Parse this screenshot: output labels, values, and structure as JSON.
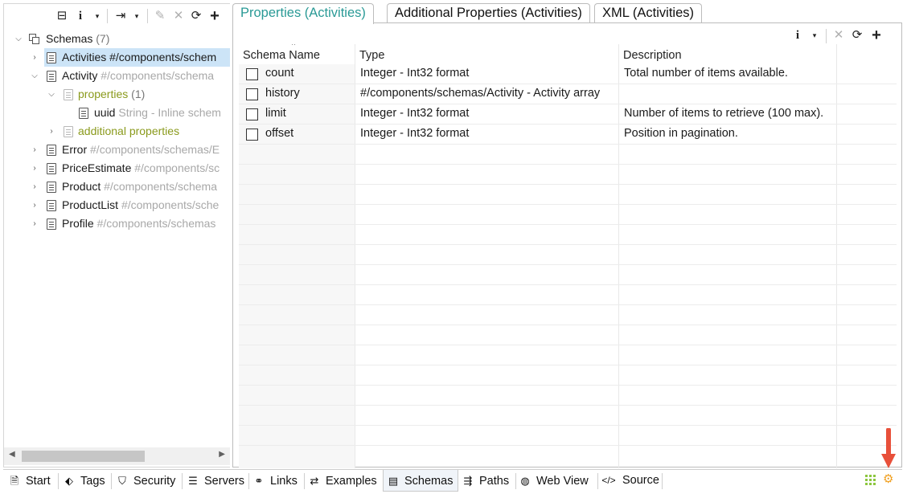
{
  "left_toolbar": {
    "collapse_icon": "⊟",
    "info_icon": "i",
    "caret": "▾",
    "export_icon": "⇥",
    "edit_icon": "✎",
    "delete_icon": "✕",
    "refresh_icon": "⟳",
    "add_icon": "+"
  },
  "tree": {
    "root": {
      "label": "Schemas",
      "count": "(7)"
    },
    "items": [
      {
        "label": "Activities",
        "ref": "#/components/schem"
      },
      {
        "label": "Activity",
        "ref": "#/components/schema"
      },
      {
        "label": "properties",
        "count": "(1)"
      },
      {
        "label": "uuid",
        "ref": "String - Inline schem"
      },
      {
        "label": "additional properties"
      },
      {
        "label": "Error",
        "ref": "#/components/schemas/E"
      },
      {
        "label": "PriceEstimate",
        "ref": "#/components/sc"
      },
      {
        "label": "Product",
        "ref": "#/components/schema"
      },
      {
        "label": "ProductList",
        "ref": "#/components/sche"
      },
      {
        "label": "Profile",
        "ref": "#/components/schemas"
      }
    ]
  },
  "tabs": [
    {
      "label": "Properties (Activities)",
      "active": true
    },
    {
      "label": "Additional Properties (Activities)",
      "active": false
    },
    {
      "label": "XML (Activities)",
      "active": false
    }
  ],
  "table_toolbar": {
    "info_icon": "i",
    "caret": "▾",
    "delete_icon": "✕",
    "refresh_icon": "⟳",
    "add_icon": "+"
  },
  "table": {
    "headers": [
      "Schema Name",
      "Type",
      "Description"
    ],
    "rows": [
      {
        "name": "count",
        "type": "Integer - Int32 format",
        "description": "Total number of items available."
      },
      {
        "name": "history",
        "type": "#/components/schemas/Activity - Activity array",
        "description": ""
      },
      {
        "name": "limit",
        "type": "Integer - Int32 format",
        "description": "Number of items to retrieve (100 max)."
      },
      {
        "name": "offset",
        "type": "Integer - Int32 format",
        "description": "Position in pagination."
      }
    ]
  },
  "bottom_tabs": [
    {
      "label": "Start",
      "icon": "document-icon",
      "glyph": "🗎"
    },
    {
      "label": "Tags",
      "icon": "tag-icon",
      "glyph": "⬖"
    },
    {
      "label": "Security",
      "icon": "shield-icon",
      "glyph": "⛉"
    },
    {
      "label": "Servers",
      "icon": "server-icon",
      "glyph": "☰"
    },
    {
      "label": "Links",
      "icon": "link-icon",
      "glyph": "⚭"
    },
    {
      "label": "Examples",
      "icon": "examples-icon",
      "glyph": "⇄"
    },
    {
      "label": "Schemas",
      "icon": "schemas-icon",
      "glyph": "▤",
      "active": true
    },
    {
      "label": "Paths",
      "icon": "paths-icon",
      "glyph": "⇶"
    },
    {
      "label": "Web View",
      "icon": "globe-icon",
      "glyph": "◍"
    },
    {
      "label": "Source",
      "icon": "code-icon",
      "glyph": "</>"
    }
  ],
  "colors": {
    "accent_tab": "#2a9a96",
    "selection": "#cce4f7",
    "olive_text": "#8a9a1c",
    "arrow_red": "#e8503a",
    "grid_green": "#8cc63f",
    "gear_orange": "#f0a020"
  }
}
